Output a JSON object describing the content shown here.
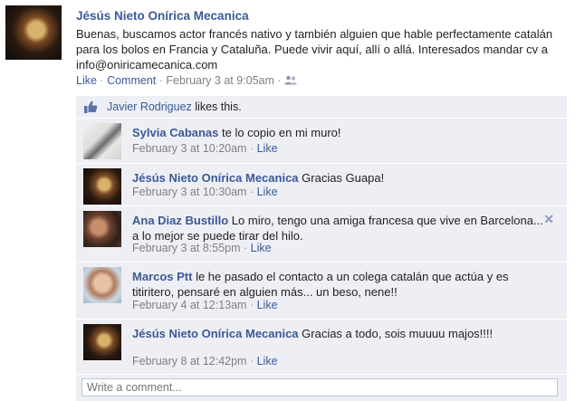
{
  "post": {
    "author": "Jésús Nieto Onírica Mecanica",
    "text": "Buenas, buscamos actor francés nativo y también alguien que hable perfectamente catalán para los bolos en Francia y Cataluña. Puede vivir aquí, allí o allá. Interesados mandar cv a info@oniricamecanica.com",
    "like_label": "Like",
    "comment_label": "Comment",
    "timestamp": "February 3 at 9:05am",
    "privacy_icon": "friends-icon"
  },
  "likes": {
    "icon": "thumbs-up-icon",
    "name": "Javier Rodriguez",
    "suffix": " likes this."
  },
  "comments": [
    {
      "author": "Sylvia Cabanas",
      "text": " te lo copio en mi muro!",
      "timestamp": "February 3 at 10:20am",
      "like_label": "Like"
    },
    {
      "author": "Jésús Nieto Onírica Mecanica",
      "text": " Gracias Guapa!",
      "timestamp": "February 3 at 10:30am",
      "like_label": "Like"
    },
    {
      "author": "Ana Diaz Bustillo",
      "text": " Lo miro, tengo una amiga francesa que vive en Barcelona... a lo mejor se puede tirar del hilo.",
      "timestamp": "February 3 at 8:55pm",
      "like_label": "Like"
    },
    {
      "author": "Marcos Ptt",
      "text": " le he pasado el contacto a un colega catalán que actúa y es titiritero, pensaré en alguien más... un beso, nene!!",
      "timestamp": "February 4 at 12:13am",
      "like_label": "Like"
    },
    {
      "author": "Jésús Nieto Onírica Mecanica",
      "text": " Gracias a todo, sois muuuu majos!!!!",
      "timestamp": "February 8 at 12:42pm",
      "like_label": "Like"
    }
  ],
  "write_comment": {
    "placeholder": "Write a comment..."
  },
  "colors": {
    "link": "#3b5998",
    "comment_bg": "#edeff4",
    "meta": "#808080"
  }
}
